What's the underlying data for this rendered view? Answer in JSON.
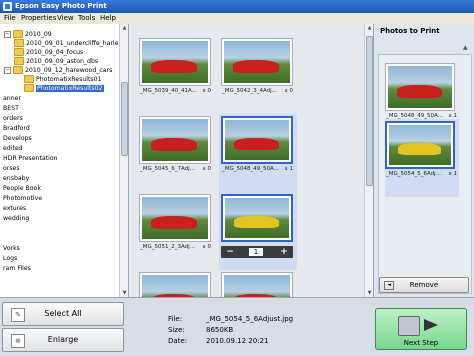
{
  "window": {
    "title": "Epson Easy Photo Print"
  },
  "menu": [
    "File",
    "Properties",
    "View",
    "Tools",
    "Help"
  ],
  "tree": {
    "nodes": [
      {
        "label": "2010_09",
        "indent": 0,
        "type": "folder"
      },
      {
        "label": "2010_09_01_undercliffe_harley",
        "indent": 1,
        "type": "folder"
      },
      {
        "label": "2010_09_04_focus",
        "indent": 1,
        "type": "folder"
      },
      {
        "label": "2010_09_09_aston_dbs",
        "indent": 1,
        "type": "folder"
      },
      {
        "label": "2010_09_12_harewood_cars",
        "indent": 1,
        "type": "folder"
      },
      {
        "label": "PhotomatixResults01",
        "indent": 2,
        "type": "folder"
      },
      {
        "label": "PhotomatixResults02",
        "indent": 2,
        "type": "folder",
        "selected": true
      },
      {
        "label": "anner",
        "indent": 0,
        "type": "text"
      },
      {
        "label": "BEST",
        "indent": 0,
        "type": "text"
      },
      {
        "label": "orders",
        "indent": 0,
        "type": "text"
      },
      {
        "label": "Bradford",
        "indent": 0,
        "type": "text"
      },
      {
        "label": "Develops",
        "indent": 0,
        "type": "text"
      },
      {
        "label": "edited",
        "indent": 0,
        "type": "text"
      },
      {
        "label": "HDR Presentation",
        "indent": 0,
        "type": "text"
      },
      {
        "label": "orses",
        "indent": 0,
        "type": "text"
      },
      {
        "label": "ensbaby",
        "indent": 0,
        "type": "text"
      },
      {
        "label": "People Book",
        "indent": 0,
        "type": "text"
      },
      {
        "label": "Photomotive",
        "indent": 0,
        "type": "text"
      },
      {
        "label": "extures",
        "indent": 0,
        "type": "text"
      },
      {
        "label": "wedding",
        "indent": 0,
        "type": "text"
      },
      {
        "label": "Vorks",
        "indent": 0,
        "type": "text"
      },
      {
        "label": "Logs",
        "indent": 0,
        "type": "text"
      },
      {
        "label": "ram Files",
        "indent": 0,
        "type": "text"
      }
    ]
  },
  "grid": {
    "thumbnails": [
      {
        "name": "_MG_5039_40_41A...",
        "count": "x 0",
        "car": "red"
      },
      {
        "name": "_MG_5042_3_4Adj...",
        "count": "x 0",
        "car": "red"
      },
      {
        "name": "_MG_5045_6_7Adj...",
        "count": "x 0",
        "car": "red"
      },
      {
        "name": "_MG_5048_49_50A...",
        "count": "x 1",
        "car": "red",
        "selected": true
      },
      {
        "name": "_MG_5051_2_3Adj...",
        "count": "x 0",
        "car": "red"
      },
      {
        "name": "_MG_5054_5_6Adj...",
        "count": "",
        "car": "yellow",
        "selected": true,
        "stepper": true
      }
    ],
    "stepper": {
      "minus": "−",
      "value": "1",
      "plus": "+"
    }
  },
  "photos_to_print": {
    "title": "Photos to Print",
    "items": [
      {
        "name": "_MG_5048_49_50A...",
        "count": "x 1",
        "car": "red"
      },
      {
        "name": "_MG_5054_5_6Adj...",
        "count": "x 1",
        "car": "yellow",
        "selected": true
      }
    ],
    "remove_label": "Remove"
  },
  "bottom": {
    "select_all_label": "Select All",
    "enlarge_label": "Enlarge",
    "info": {
      "file_label": "File:",
      "file_value": "_MG_5054_5_6Adjust.jpg",
      "size_label": "Size:",
      "size_value": "8650KB",
      "date_label": "Date:",
      "date_value": "2010.09.12 20:21"
    },
    "next_label": "Next Step"
  },
  "colors": {
    "selection": "#316ac5",
    "next_green": "#76d68d",
    "titlebar": "#1d55b8"
  },
  "icons": [
    "folder-icon",
    "remove-icon",
    "select-all-icon",
    "enlarge-icon",
    "printer-icon",
    "arrow-right-icon"
  ]
}
